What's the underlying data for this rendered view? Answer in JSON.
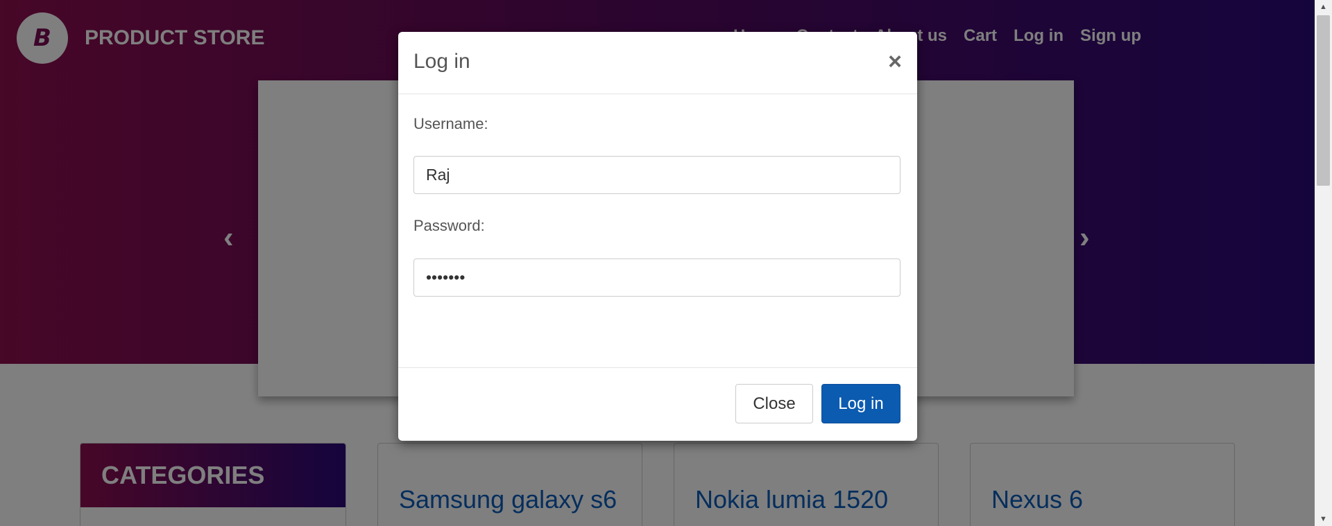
{
  "header": {
    "brand_name": "PRODUCT STORE",
    "logo_letter": "B",
    "nav": [
      "Home",
      "Contact",
      "About us",
      "Cart",
      "Log in",
      "Sign up"
    ]
  },
  "carousel": {
    "prev_icon": "‹",
    "next_icon": "›"
  },
  "categories": {
    "title": "CATEGORIES"
  },
  "products": [
    "Samsung galaxy s6",
    "Nokia lumia 1520",
    "Nexus 6"
  ],
  "modal": {
    "title": "Log in",
    "close_icon": "×",
    "username_label": "Username:",
    "username_value": "Raj",
    "password_label": "Password:",
    "password_value": "•••••••",
    "close_button": "Close",
    "login_button": "Log in"
  },
  "scrollbar": {
    "up_icon": "▲",
    "down_icon": "▼"
  }
}
